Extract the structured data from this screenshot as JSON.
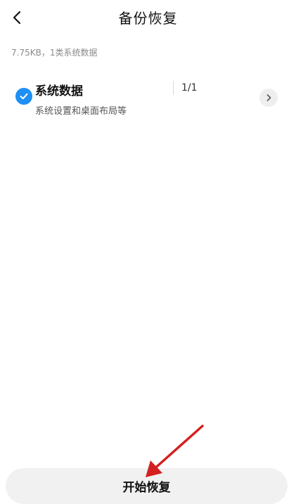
{
  "header": {
    "title": "备份恢复",
    "back_icon": "chevron-left-icon"
  },
  "summary": {
    "text": "7.75KB，1类系统数据"
  },
  "items": [
    {
      "title": "系统数据",
      "subtitle": "系统设置和桌面布局等",
      "count": "1/1",
      "checked": true,
      "check_icon": "check-icon",
      "detail_icon": "chevron-right-icon"
    }
  ],
  "footer": {
    "start_label": "开始恢复"
  },
  "colors": {
    "accent": "#1e8ff5",
    "annotation": "#d42020",
    "button_bg": "#f1f1f1"
  }
}
